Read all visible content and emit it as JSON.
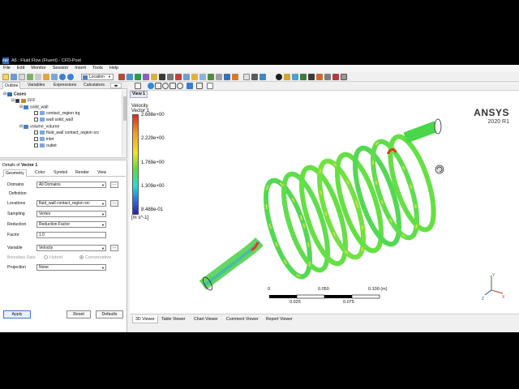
{
  "window": {
    "title": "A6 : Fluid Flow (Fluent) - CFD-Post",
    "icon_text": "PST"
  },
  "menu": [
    "File",
    "Edit",
    "Monitor",
    "Session",
    "Insert",
    "Tools",
    "Help"
  ],
  "toolbar": {
    "location_label": "Location"
  },
  "left_tabs": [
    "Outline",
    "Variables",
    "Expressions",
    "Calculators"
  ],
  "tree": {
    "root": "Cases",
    "items": [
      {
        "label": "FFF",
        "level": 1
      },
      {
        "label": "solid_wall",
        "level": 2
      },
      {
        "label": "contact_region trg",
        "level": 3
      },
      {
        "label": "wall solid_wall",
        "level": 3
      },
      {
        "label": "volume_volume",
        "level": 2
      },
      {
        "label": "fluid_wall contact_region src",
        "level": 3
      },
      {
        "label": "inlet",
        "level": 3
      },
      {
        "label": "outlet",
        "level": 3
      }
    ]
  },
  "details": {
    "title_prefix": "Details of",
    "object": "Vector 1",
    "tabs": [
      "Geometry",
      "Color",
      "Symbol",
      "Render",
      "View"
    ],
    "domains_label": "Domains",
    "domains_value": "All Domains",
    "definition_label": "Definition",
    "locations_label": "Locations",
    "locations_value": "fluid_wall contact_region src",
    "sampling_label": "Sampling",
    "sampling_value": "Vertex",
    "reduction_label": "Reduction",
    "reduction_value": "Reduction Factor",
    "factor_label": "Factor",
    "factor_value": "1.0",
    "variable_label": "Variable",
    "variable_value": "Velocity",
    "boundary_label": "Boundary Data",
    "hybrid_label": "Hybrid",
    "conservative_label": "Conservative",
    "projection_label": "Projection",
    "projection_value": "None",
    "ellipsis": "..."
  },
  "buttons": {
    "apply": "Apply",
    "reset": "Reset",
    "defaults": "Defaults"
  },
  "viewport": {
    "view_label": "View 1",
    "legend_title_1": "Velocity",
    "legend_title_2": "Vector 1",
    "legend_values": [
      "2.688e+00",
      "2.229e+00",
      "1.769e+00",
      "1.309e+00",
      "8.488e-01"
    ],
    "legend_unit": "[m s^-1]",
    "brand": "ANSYS",
    "version": "2020 R1",
    "scale_top": [
      "0",
      "0.050",
      "0.100  (m)"
    ],
    "scale_bottom": [
      "0.025",
      "0.075"
    ]
  },
  "viewer_tabs": [
    "3D Viewer",
    "Table Viewer",
    "Chart Viewer",
    "Comment Viewer",
    "Report Viewer"
  ],
  "colors": {
    "accent": "#3b78c9",
    "coil_green": "#44d84a",
    "coil_red": "#e33a1e"
  }
}
